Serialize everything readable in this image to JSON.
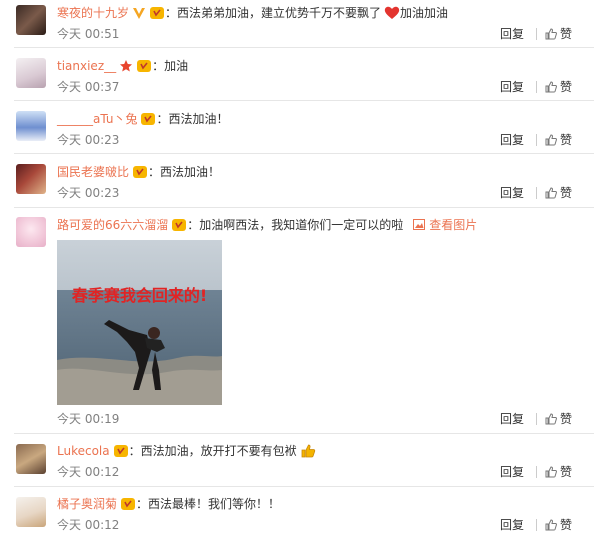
{
  "colors": {
    "username": "#eb7350",
    "time": "#808080",
    "text": "#333333",
    "separator": "#e6e6e6"
  },
  "comments": [
    {
      "user": "寒夜的十九岁",
      "text": "：西法弟弟加油，建立优势千万不要飘了",
      "text_after": "加油加油",
      "time": "今天 00:51",
      "reply": "回复",
      "like": "赞",
      "badges": [
        "vip-v-icon",
        "fan-badge-icon"
      ]
    },
    {
      "user": "tianxiez__",
      "text": "：加油",
      "time": "今天 00:37",
      "reply": "回复",
      "like": "赞",
      "badges": [
        "star-icon",
        "fan-badge-icon"
      ]
    },
    {
      "user": "______aTu丶兔",
      "text": "：西法加油！",
      "time": "今天 00:23",
      "reply": "回复",
      "like": "赞",
      "badges": [
        "fan-badge-icon"
      ]
    },
    {
      "user": "国民老婆啵比",
      "text": "：西法加油！",
      "time": "今天 00:23",
      "reply": "回复",
      "like": "赞",
      "badges": [
        "fan-badge-icon"
      ]
    },
    {
      "user": "路可爱的66六六溜溜",
      "text": "：加油啊西法，我知道你们一定可以的啦",
      "view_pic": "查看图片",
      "photo_caption": "春季赛我会回来的!",
      "time": "今天 00:19",
      "reply": "回复",
      "like": "赞",
      "badges": [
        "fan-badge-icon"
      ]
    },
    {
      "user": "Lukecola",
      "text": "：西法加油，放开打不要有包袱",
      "time": "今天 00:12",
      "reply": "回复",
      "like": "赞",
      "badges": [
        "fan-badge-icon"
      ]
    },
    {
      "user": "橘子奥润菊",
      "text": "：西法最棒！我们等你！！",
      "time": "今天 00:12",
      "reply": "回复",
      "like": "赞",
      "badges": [
        "fan-badge-icon"
      ]
    }
  ]
}
